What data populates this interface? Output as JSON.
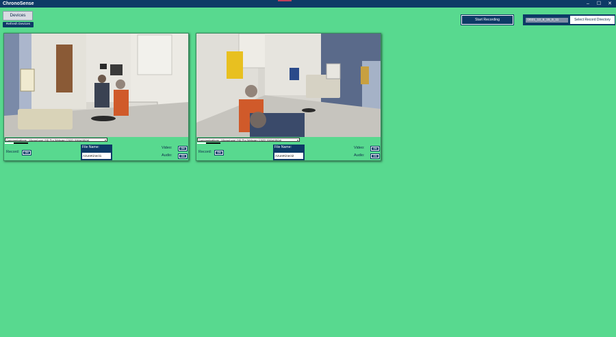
{
  "app": {
    "title": "ChronoSense",
    "colors": {
      "background": "#58d98f",
      "primary": "#0e3a66",
      "titlebar": "#0e3a66"
    }
  },
  "window_controls": {
    "minimize": "–",
    "maximize": "☐",
    "close": "✕"
  },
  "toolbar": {
    "devices_label": "Devices",
    "refresh_label": "Refresh Devices",
    "start_recording_label": "Start Recording",
    "record_directory": "/2021_12_6_15_9_11",
    "select_directory_label": "Select Record Directory"
  },
  "cameras": [
    {
      "microphone": "Communications - Microphone (HD Pro Webcam C920) (046d:082d)",
      "audio_level": 0.38,
      "record_label": "Record:",
      "record_state": "ON",
      "file_name_label": "File Name:",
      "file_name": "AzureKinect1",
      "video_label": "Video:",
      "video_state": "ON",
      "audio_label": "Audio:",
      "audio_state": "ON"
    },
    {
      "microphone": "Communications - Microphone (HD Pro Webcam C920) (046d:082d)",
      "audio_level": 0.38,
      "record_label": "Record:",
      "record_state": "ON",
      "file_name_label": "File Name:",
      "file_name": "AzureKinect2",
      "video_label": "Video:",
      "video_state": "ON",
      "audio_label": "Audio:",
      "audio_state": "ON"
    }
  ]
}
